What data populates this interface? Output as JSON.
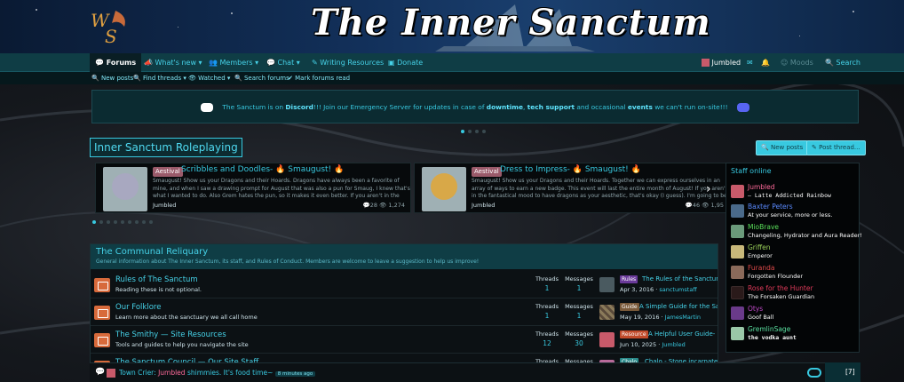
{
  "banner": {
    "title": "The Inner Sanctum",
    "logo_text": "WS"
  },
  "nav": {
    "forums": "Forums",
    "whats_new": "What's new",
    "members": "Members",
    "chat": "Chat",
    "writing": "Writing Resources",
    "donate": "Donate",
    "user": "Jumbled",
    "moods": "Moods",
    "search": "Search"
  },
  "subnav": {
    "new_posts": "New posts",
    "find_threads": "Find threads",
    "watched": "Watched",
    "search_forums": "Search forums",
    "mark_read": "Mark forums read"
  },
  "notice": {
    "p1": "The Sanctum is on ",
    "discord": "Discord",
    "p2": "!!! Join our Emergency Server for updates in case of ",
    "downtime": "downtime",
    "p3": ", ",
    "tech": "tech support",
    "p4": " and occasional ",
    "events": "events",
    "p5": " we can't run on-site!!!"
  },
  "page": {
    "title": "Inner Sanctum Roleplaying",
    "new_posts_btn": "New posts",
    "post_thread_btn": "Post thread..."
  },
  "featured": [
    {
      "tag": "Aestival",
      "title": "Scribbles and Doodles- 🔥 Smaugust! 🔥",
      "desc": "Smaugust! Show us your Dragons and their Hoards. Dragons have always been a favorite of mine, and when I saw a drawing prompt for August that was also a pun for Smaug, I knew that's what I wanted to do. Also Grem hates the pun, so it makes it even better. If you aren't in the fantastical...",
      "author": "Jumbled",
      "replies": "28",
      "views": "1,274",
      "medal_color": "#a8a8c0"
    },
    {
      "tag": "Aestival",
      "title": "Dress to Impress- 🔥 Smaugust! 🔥",
      "desc": "Smaugust! Show us your Dragons and their Hoards. Together we can express ourselves in an array of ways to earn a new badge. This event will last the entire month of August! If you aren't in the fantastical mood to have dragons as your aesthetic, that's okay (I guess). I'm going to be a...",
      "author": "Jumbled",
      "replies": "46",
      "views": "1,95",
      "medal_color": "#d8a848"
    }
  ],
  "category": {
    "title": "The Communal Reliquary",
    "desc": "General information about The Inner Sanctum, its staff, and Rules of Conduct. Members are welcome to leave a suggestion to help us improve!",
    "threads_label": "Threads",
    "messages_label": "Messages",
    "nodes": [
      {
        "title": "Rules of The Sanctum",
        "desc": "Reading these is not optional.",
        "threads": "1",
        "messages": "1",
        "last_tag": "Rules",
        "last_tag_color": "#6a3a9a",
        "last_title": "The Rules of the Sanctum",
        "last_date": "Apr 3, 2016",
        "last_user": "sanctumstaff"
      },
      {
        "title": "Our Folklore",
        "desc": "Learn more about the sanctuary we all call home",
        "threads": "1",
        "messages": "1",
        "last_tag": "Guide",
        "last_tag_color": "#7a5a3a",
        "last_title": "A Simple Guide for the Sanc...",
        "last_date": "May 19, 2016",
        "last_user": "JamesMartin"
      },
      {
        "title": "The Smithy — Site Resources",
        "desc": "Tools and guides to help you navigate the site",
        "threads": "12",
        "messages": "30",
        "last_tag": "Resource",
        "last_tag_color": "#c04a2a",
        "last_title": "A Helpful User Guide- no...",
        "last_date": "Jun 10, 2025",
        "last_user": "Jumbled"
      },
      {
        "title": "The Sanctum Council — Our Site Staff",
        "desc": "",
        "threads": "",
        "messages": "",
        "last_tag": "Chalo",
        "last_tag_color": "#2a8a8a",
        "last_title": "Chalo - Stone incarnate",
        "last_date": "",
        "last_user": ""
      }
    ]
  },
  "staff": {
    "heading": "Staff online",
    "members": [
      {
        "name": "Jumbled",
        "role": "— Latte Addicted Rainbow",
        "color": "#ff6a9a",
        "av": "#c85a6a"
      },
      {
        "name": "Baxter Peters",
        "role": "At your service, more or less.",
        "color": "#5a8aff",
        "av": "#4a6a8a"
      },
      {
        "name": "MioBrave",
        "role": "Changeling, Hydrator and Aura Reader!",
        "color": "#5ae05a",
        "av": "#6a9a7a"
      },
      {
        "name": "Griffen",
        "role": "Emperor",
        "color": "#9ad05a",
        "av": "#c8b87a"
      },
      {
        "name": "Furanda",
        "role": "Forgotten Flounder",
        "color": "#e04a4a",
        "av": "#8a6a5a"
      },
      {
        "name": "Rose for the Hunter",
        "role": "The Forsaken Guardian",
        "color": "#e03a5a",
        "av": "#2a1a1a"
      },
      {
        "name": "Otys",
        "role": "Goof Ball",
        "color": "#c04ac8",
        "av": "#6a3a8a"
      },
      {
        "name": "GremlinSage",
        "role": "the vodka aunt",
        "color": "#5ae0a0",
        "av": "#9ac8a8"
      }
    ]
  },
  "shoutbox": {
    "prefix": "Town Crier: ",
    "user": "Jumbled",
    "msg": " shimmies. It's food time~",
    "time": "8 minutes ago",
    "count": "[7]"
  }
}
